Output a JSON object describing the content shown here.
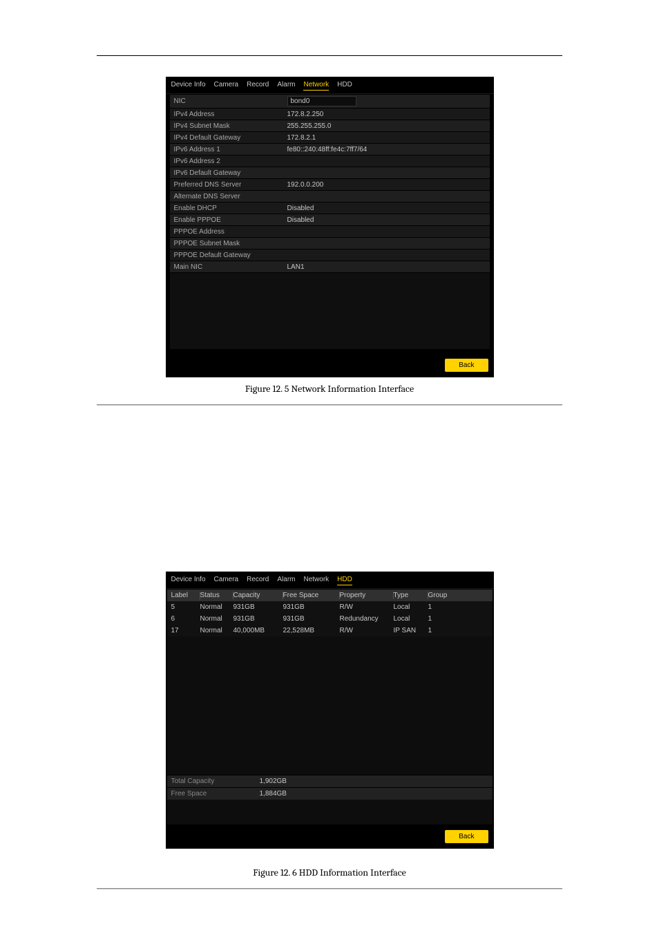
{
  "tabs": {
    "device_info": "Device Info",
    "camera": "Camera",
    "record": "Record",
    "alarm": "Alarm",
    "network": "Network",
    "hdd": "HDD"
  },
  "network": {
    "rows": {
      "nic": {
        "label": "NIC",
        "value": "bond0"
      },
      "ipv4_addr": {
        "label": "IPv4 Address",
        "value": "172.8.2.250"
      },
      "ipv4_mask": {
        "label": "IPv4 Subnet Mask",
        "value": "255.255.255.0"
      },
      "ipv4_gw": {
        "label": "IPv4 Default Gateway",
        "value": "172.8.2.1"
      },
      "ipv6_addr1": {
        "label": "IPv6 Address 1",
        "value": "fe80::240:48ff:fe4c:7ff7/64"
      },
      "ipv6_addr2": {
        "label": "IPv6 Address 2",
        "value": ""
      },
      "ipv6_gw": {
        "label": "IPv6 Default Gateway",
        "value": ""
      },
      "pref_dns": {
        "label": "Preferred DNS Server",
        "value": "192.0.0.200"
      },
      "alt_dns": {
        "label": "Alternate DNS Server",
        "value": ""
      },
      "dhcp": {
        "label": "Enable DHCP",
        "value": "Disabled"
      },
      "pppoe": {
        "label": "Enable PPPOE",
        "value": "Disabled"
      },
      "pppoe_addr": {
        "label": "PPPOE Address",
        "value": ""
      },
      "pppoe_mask": {
        "label": "PPPOE Subnet Mask",
        "value": ""
      },
      "pppoe_gw": {
        "label": "PPPOE Default Gateway",
        "value": ""
      },
      "main_nic": {
        "label": "Main NIC",
        "value": "LAN1"
      }
    },
    "back": "Back",
    "caption": "Figure 12. 5 Network Information Interface"
  },
  "hdd": {
    "headers": {
      "label": "Label",
      "status": "Status",
      "capacity": "Capacity",
      "free_space": "Free Space",
      "property": "Property",
      "type": "Type",
      "group": "Group"
    },
    "rows": [
      {
        "label": "5",
        "status": "Normal",
        "capacity": "931GB",
        "free_space": "931GB",
        "property": "R/W",
        "type": "Local",
        "group": "1"
      },
      {
        "label": "6",
        "status": "Normal",
        "capacity": "931GB",
        "free_space": "931GB",
        "property": "Redundancy",
        "type": "Local",
        "group": "1"
      },
      {
        "label": "17",
        "status": "Normal",
        "capacity": "40,000MB",
        "free_space": "22,528MB",
        "property": "R/W",
        "type": "IP SAN",
        "group": "1"
      }
    ],
    "summary": {
      "total_capacity": {
        "label": "Total Capacity",
        "value": "1,902GB"
      },
      "free_space": {
        "label": "Free Space",
        "value": "1,884GB"
      }
    },
    "back": "Back",
    "caption": "Figure 12. 6 HDD Information Interface"
  }
}
